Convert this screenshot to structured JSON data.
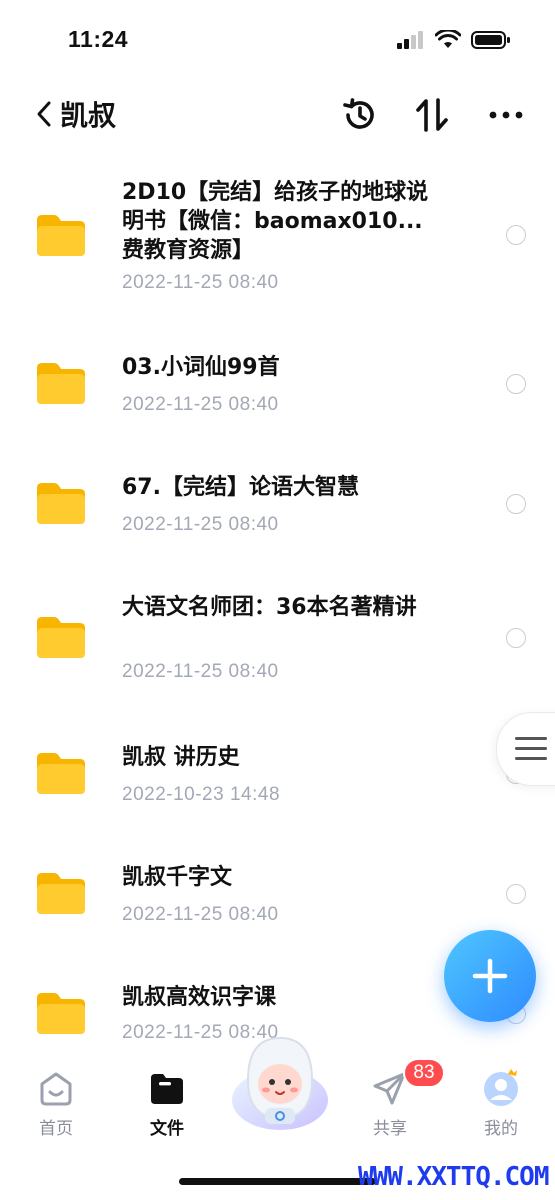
{
  "status_bar": {
    "time": "11:24"
  },
  "nav": {
    "title": "凯叔"
  },
  "files": [
    {
      "name": "2D10【完结】给孩子的地球说明书【微信：baomax010...费教育资源】",
      "date": "2022-11-25 08:40"
    },
    {
      "name": "03.小词仙99首",
      "date": "2022-11-25 08:40"
    },
    {
      "name": "67.【完结】论语大智慧",
      "date": "2022-11-25 08:40"
    },
    {
      "name": "大语文名师团：36本名著精讲",
      "date": "2022-11-25 08:40"
    },
    {
      "name": "凯叔 讲历史",
      "date": "2022-10-23 14:48"
    },
    {
      "name": "凯叔千字文",
      "date": "2022-11-25 08:40"
    },
    {
      "name": "凯叔高效识字课",
      "date": "2022-11-25 08:40"
    }
  ],
  "tabs": [
    {
      "label": "首页",
      "icon": "home-icon"
    },
    {
      "label": "文件",
      "icon": "folder-icon"
    },
    {
      "label": "共享",
      "icon": "send-icon",
      "badge": "83"
    },
    {
      "label": "我的",
      "icon": "avatar-icon"
    }
  ],
  "watermark": "WWW.XXTTQ.COM",
  "colors": {
    "accent": "#2e8bff",
    "folder": "#ffcb2f",
    "badge": "#ff4d4f",
    "date": "#a3a8b5"
  }
}
